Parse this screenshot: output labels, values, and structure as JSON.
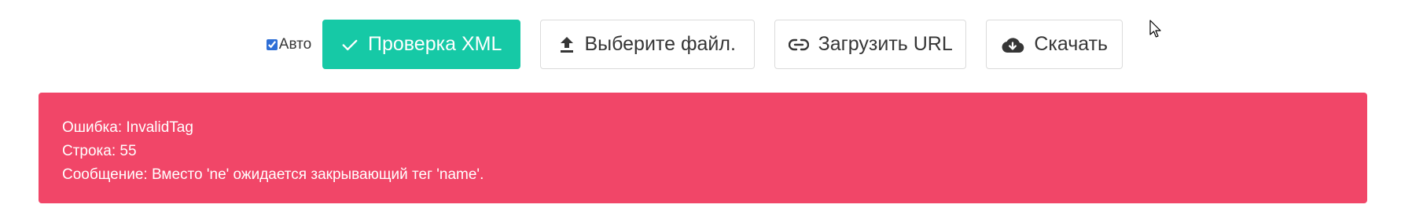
{
  "toolbar": {
    "auto_label": "Авто",
    "auto_checked": true,
    "validate_label": "Проверка XML",
    "choose_file_label": "Выберите файл.",
    "load_url_label": "Загрузить URL",
    "download_label": "Скачать"
  },
  "icons": {
    "validate": "check-icon",
    "choose_file": "upload-icon",
    "load_url": "link-icon",
    "download": "cloud-download-icon"
  },
  "error": {
    "line1": "Ошибка: InvalidTag",
    "line2": "Строка: 55",
    "line3": "Сообщение: Вместо 'ne' ожидается закрывающий тег 'name'."
  },
  "colors": {
    "primary": "#16c9a6",
    "danger": "#f14668",
    "text": "#363636",
    "border": "#dbdbdb"
  }
}
